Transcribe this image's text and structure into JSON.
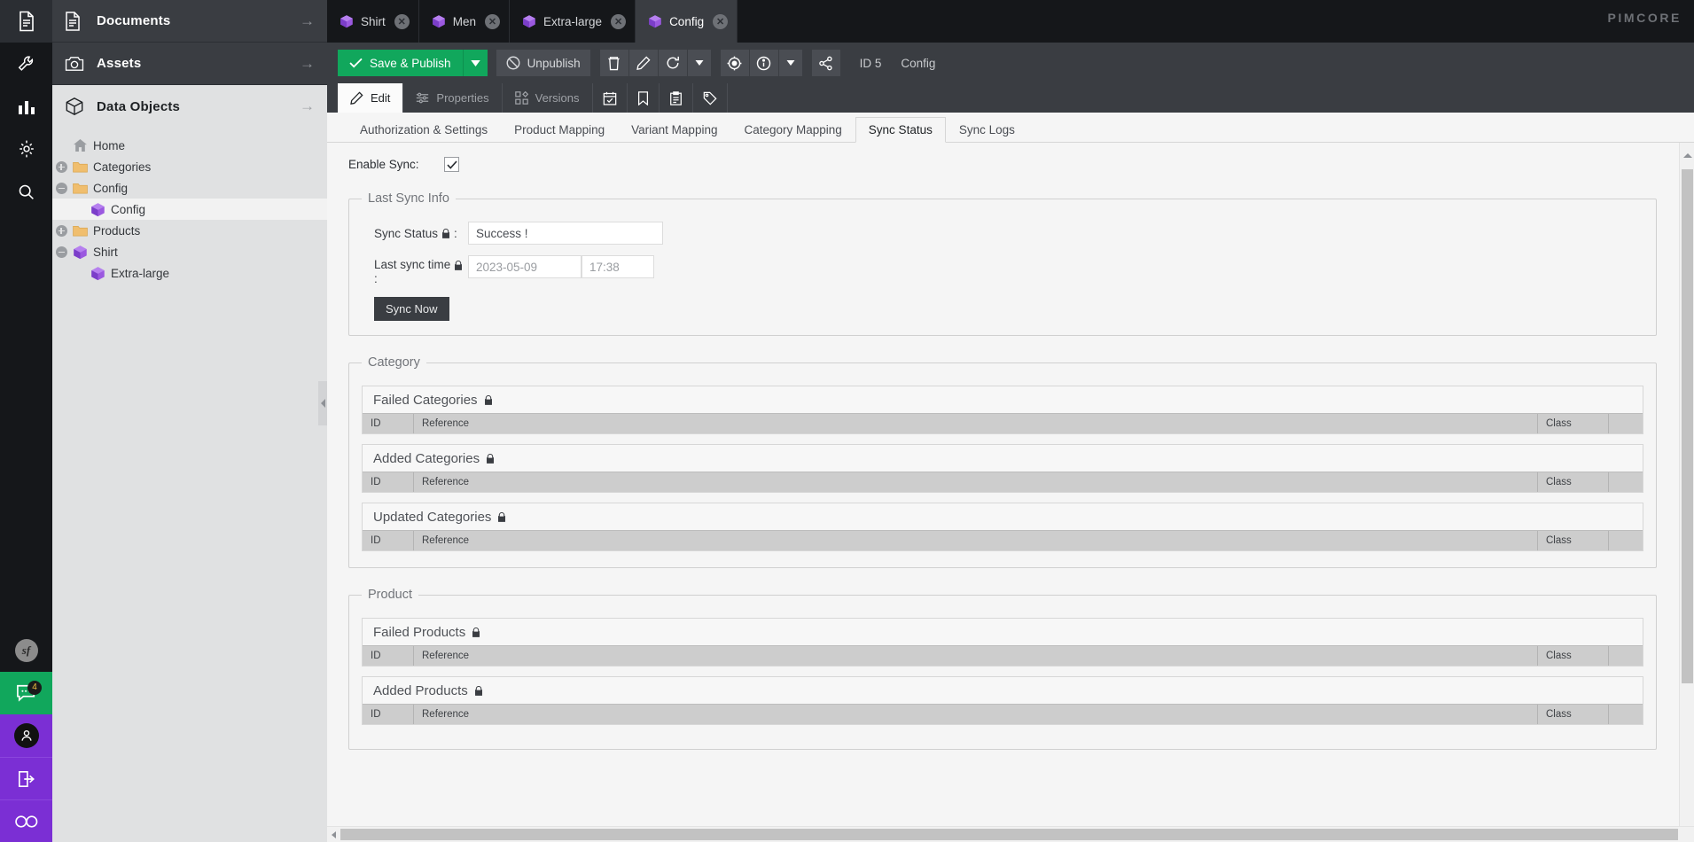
{
  "brand": {
    "logo_text": "PIMCORE"
  },
  "rail": {
    "items": [
      {
        "name": "documents-rail-icon",
        "icon": "file-icon"
      },
      {
        "name": "settings-rail-icon",
        "icon": "wrench-icon"
      },
      {
        "name": "reports-rail-icon",
        "icon": "bar-chart-icon"
      },
      {
        "name": "system-settings-rail-icon",
        "icon": "gear-icon"
      },
      {
        "name": "search-rail-icon",
        "icon": "search-icon"
      }
    ],
    "symfony_label": "sf",
    "chat_badge": "4"
  },
  "tree_panel": {
    "sections": [
      {
        "label": "Documents",
        "icon": "document-icon",
        "arrow": "→",
        "theme": "dark"
      },
      {
        "label": "Assets",
        "icon": "camera-icon",
        "arrow": "→",
        "theme": "dark"
      },
      {
        "label": "Data Objects",
        "icon": "cube-outline-icon",
        "arrow": "→",
        "theme": "light"
      }
    ],
    "tree": [
      {
        "label": "Home",
        "indent": 0,
        "toggle": "none",
        "icon": "home-icon",
        "selected": false
      },
      {
        "label": "Categories",
        "indent": 0,
        "toggle": "plus",
        "icon": "folder-icon",
        "selected": false
      },
      {
        "label": "Config",
        "indent": 0,
        "toggle": "minus",
        "icon": "folder-icon",
        "selected": false
      },
      {
        "label": "Config",
        "indent": 1,
        "toggle": "none",
        "icon": "cube-icon",
        "selected": true
      },
      {
        "label": "Products",
        "indent": 0,
        "toggle": "plus",
        "icon": "folder-icon",
        "selected": false
      },
      {
        "label": "Shirt",
        "indent": 0,
        "toggle": "minus",
        "icon": "cube-icon",
        "selected": false
      },
      {
        "label": "Extra-large",
        "indent": 1,
        "toggle": "none",
        "icon": "cube-icon",
        "selected": false
      }
    ]
  },
  "doc_tabs": [
    {
      "label": "Shirt",
      "active": false,
      "close": "✕"
    },
    {
      "label": "Men",
      "active": false,
      "close": "✕"
    },
    {
      "label": "Extra-large",
      "active": false,
      "close": "✕"
    },
    {
      "label": "Config",
      "active": true,
      "close": "✕"
    }
  ],
  "toolbar": {
    "save_label": "Save & Publish",
    "unpublish_label": "Unpublish",
    "id_label": "ID 5",
    "object_label": "Config",
    "icons": [
      {
        "name": "delete-icon"
      },
      {
        "name": "edit-icon"
      },
      {
        "name": "reload-icon"
      },
      {
        "name": "reload-dropdown-icon"
      },
      {
        "name": "locate-icon"
      },
      {
        "name": "info-icon"
      },
      {
        "name": "info-dropdown-icon"
      },
      {
        "name": "share-icon"
      }
    ]
  },
  "inner_tabs": [
    {
      "label": "Edit",
      "icon": "pencil-icon",
      "active": true
    },
    {
      "label": "Properties",
      "icon": "sliders-icon",
      "active": false
    },
    {
      "label": "Versions",
      "icon": "grid-shapes-icon",
      "active": false
    },
    {
      "label": "",
      "icon": "schedule-icon",
      "active": false
    },
    {
      "label": "",
      "icon": "bookmark-icon",
      "active": false
    },
    {
      "label": "",
      "icon": "clipboard-icon",
      "active": false
    },
    {
      "label": "",
      "icon": "tag-icon",
      "active": false
    }
  ],
  "sub_tabs": [
    {
      "label": "Authorization & Settings",
      "active": false
    },
    {
      "label": "Product Mapping",
      "active": false
    },
    {
      "label": "Variant Mapping",
      "active": false
    },
    {
      "label": "Category Mapping",
      "active": false
    },
    {
      "label": "Sync Status",
      "active": true
    },
    {
      "label": "Sync Logs",
      "active": false
    }
  ],
  "form": {
    "enable_sync_label": "Enable Sync:",
    "enable_sync_checked": true,
    "last_sync_info": {
      "legend": "Last Sync Info",
      "sync_status_label": "Sync Status",
      "sync_status_value": "Success !",
      "last_sync_time_label": "Last sync time",
      "last_sync_date": "2023-05-09",
      "last_sync_time": "17:38",
      "sync_now_label": "Sync Now",
      "lock_icon": "lock-icon",
      "colon": ":"
    },
    "grid_columns": [
      "ID",
      "Reference",
      "Class",
      ""
    ],
    "sections": [
      {
        "legend": "Category",
        "grids": [
          {
            "title": "Failed Categories",
            "lock": true
          },
          {
            "title": "Added Categories",
            "lock": true
          },
          {
            "title": "Updated Categories",
            "lock": true
          }
        ]
      },
      {
        "legend": "Product",
        "grids": [
          {
            "title": "Failed Products",
            "lock": true
          },
          {
            "title": "Added Products",
            "lock": true
          }
        ]
      }
    ]
  },
  "colors": {
    "accent_green": "#11a75c",
    "purple": "#7b2fd4",
    "dark": "#15171a",
    "toolbar": "#3a3d42"
  }
}
